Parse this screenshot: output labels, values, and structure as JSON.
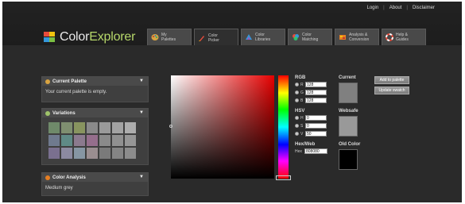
{
  "top_links": [
    "Login",
    "About",
    "Disclaimer"
  ],
  "logo": {
    "color": "Color",
    "explorer": "Explorer"
  },
  "tabs": [
    {
      "label": "My\nPalettes",
      "icon": "palette-icon"
    },
    {
      "label": "Color\nPicker",
      "icon": "brush-icon"
    },
    {
      "label": "Color\nLibraries",
      "icon": "library-icon"
    },
    {
      "label": "Color\nMatching",
      "icon": "color-wheel-icon"
    },
    {
      "label": "Analysis &\nConversion",
      "icon": "analysis-icon"
    },
    {
      "label": "Help &\nGuides",
      "icon": "lifebuoy-icon"
    }
  ],
  "current_palette": {
    "title": "Current Palette",
    "message": "Your current palette is empty."
  },
  "variations": {
    "title": "Variations",
    "left_colors": [
      "#6f8a6a",
      "#7f8f70",
      "#88945f",
      "#8a8a8a",
      "#6f7a8e",
      "#5f8a86",
      "#8b7a8e",
      "#956e8c",
      "#7a708f",
      "#8c8aa0",
      "#8696a3",
      "#9a8e90"
    ],
    "right_colors": [
      "#9a9a9a",
      "#a3a3a3",
      "#adadad",
      "#8a8a8a",
      "#909090",
      "#969696",
      "#7a7a7a",
      "#848484",
      "#8c8c8c"
    ]
  },
  "color_analysis": {
    "title": "Color Analysis",
    "result": "Medium grey"
  },
  "rgb": {
    "label": "RGB",
    "fields": [
      {
        "name": "R",
        "value": "128"
      },
      {
        "name": "G",
        "value": "128"
      },
      {
        "name": "B",
        "value": "128"
      }
    ]
  },
  "hsv": {
    "label": "HSV",
    "fields": [
      {
        "name": "H",
        "value": "0"
      },
      {
        "name": "S",
        "value": "0"
      },
      {
        "name": "V",
        "value": "50"
      }
    ]
  },
  "hexweb": {
    "label": "Hex/Web",
    "prefix": "Hex",
    "value": "808080"
  },
  "current": {
    "label": "Current",
    "color": "#808080"
  },
  "websafe": {
    "label": "Websafe",
    "color": "#999999"
  },
  "old_color": {
    "label": "Old Color",
    "color": "#000000"
  },
  "buttons": {
    "add": "Add to palette",
    "update": "Update swatch"
  },
  "accent_color": "#b6d76a"
}
